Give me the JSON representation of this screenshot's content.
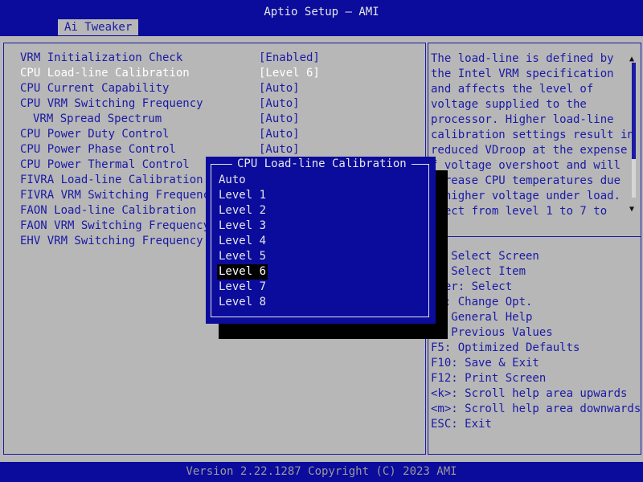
{
  "header": {
    "title": "Aptio Setup – AMI",
    "tab": "Ai Tweaker"
  },
  "settings": [
    {
      "label": "VRM Initialization Check",
      "value": "[Enabled]",
      "selected": false,
      "indent": false
    },
    {
      "label": "CPU Load-line Calibration",
      "value": "[Level 6]",
      "selected": true,
      "indent": false
    },
    {
      "label": "CPU Current Capability",
      "value": "[Auto]",
      "selected": false,
      "indent": false
    },
    {
      "label": "CPU VRM Switching Frequency",
      "value": "[Auto]",
      "selected": false,
      "indent": false
    },
    {
      "label": "VRM Spread Spectrum",
      "value": "[Auto]",
      "selected": false,
      "indent": true
    },
    {
      "label": "CPU Power Duty Control",
      "value": "[Auto]",
      "selected": false,
      "indent": false
    },
    {
      "label": "CPU Power Phase Control",
      "value": "[Auto]",
      "selected": false,
      "indent": false
    },
    {
      "label": "CPU Power Thermal Control",
      "value": "",
      "selected": false,
      "indent": false
    },
    {
      "label": "FIVRA Load-line Calibration",
      "value": "",
      "selected": false,
      "indent": false
    },
    {
      "label": "FIVRA VRM Switching Frequency",
      "value": "",
      "selected": false,
      "indent": false
    },
    {
      "label": "FAON Load-line Calibration",
      "value": "",
      "selected": false,
      "indent": false
    },
    {
      "label": "FAON VRM Switching Frequency",
      "value": "",
      "selected": false,
      "indent": false
    },
    {
      "label": "EHV VRM Switching Frequency",
      "value": "",
      "selected": false,
      "indent": false
    }
  ],
  "help": {
    "text": "The load-line is defined by\nthe Intel VRM specification\nand affects the level of\nvoltage supplied to the\nprocessor. Higher load-line\ncalibration settings result in\nreduced VDroop at the expense\nf voltage overshoot and will\n  rease CPU temperatures due\n  higher voltage under load.\n  ect from level 1 to 7 to",
    "keys": "   Select Screen\n   Select Item\n  er: Select\n  : Change Opt.\n   General Help\n   Previous Values\nF5: Optimized Defaults\nF10: Save & Exit\nF12: Print Screen\n<k>: Scroll help area upwards\n<m>: Scroll help area downwards\nESC: Exit"
  },
  "popup": {
    "title": "CPU Load-line Calibration",
    "options": [
      "Auto",
      "Level 1",
      "Level 2",
      "Level 3",
      "Level 4",
      "Level 5",
      "Level 6",
      "Level 7",
      "Level 8"
    ],
    "selected_index": 6
  },
  "footer": {
    "version": "Version 2.22.1287 Copyright (C) 2023 AMI"
  },
  "colors": {
    "title_bar": "#0b0b9c",
    "background": "#b7b7b7",
    "text": "#1a1aa6",
    "selected_text": "#ffffff"
  }
}
